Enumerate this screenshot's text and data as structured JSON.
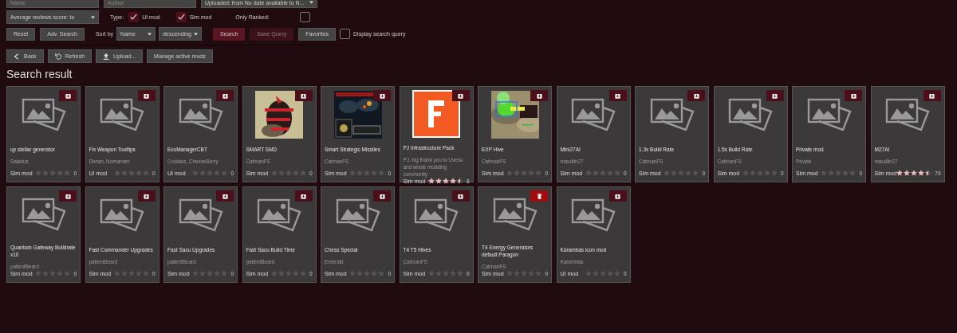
{
  "filters": {
    "row1": [
      {
        "kind": "input",
        "placeholder": "Name"
      },
      {
        "kind": "input",
        "placeholder": "Author"
      },
      {
        "kind": "dropdown",
        "value": "Uploaded: from No date available to N..."
      }
    ],
    "score_dropdown": {
      "value": "Average reviews score:  to"
    },
    "type_label": "Type:",
    "type_options": [
      {
        "label": "UI mod",
        "checked": true
      },
      {
        "label": "Sim mod",
        "checked": true
      }
    ],
    "only_ranked": {
      "label": "Only Ranked:",
      "checked": false
    },
    "reset": "Reset",
    "adv_search": "Adv. Search",
    "sort_label": "Sort by",
    "sort_field": {
      "value": "Name"
    },
    "sort_order": {
      "value": "descending"
    },
    "search": "Search",
    "save_query": {
      "label": "Save Query",
      "disabled": true
    },
    "favorites": "Favorites",
    "display_query": {
      "label": "Display search query",
      "checked": false
    }
  },
  "toolbar": [
    {
      "kind": "back",
      "label": "Back"
    },
    {
      "kind": "refresh",
      "label": "Refresh"
    },
    {
      "kind": "upload",
      "label": "Upload..."
    },
    {
      "kind": "plain",
      "label": "Manage active mods"
    }
  ],
  "heading": "Search result",
  "mods": [
    {
      "title": "up stellar generator",
      "author": "Salarius",
      "type": "Sim mod",
      "stars": 0,
      "count": "0",
      "installed": false
    },
    {
      "title": "Fix Weapon Tooltips",
      "author": "Divran, Nomander",
      "type": "UI mod",
      "stars": 0,
      "count": "0",
      "installed": false
    },
    {
      "title": "EcoManagerCBT",
      "author": "Crotalus, CheeseBerry",
      "type": "UI mod",
      "stars": 0,
      "count": "0",
      "installed": false
    },
    {
      "kind": "picture",
      "title": "SMART SMD",
      "author": "CatmanFS",
      "type": "Sim mod",
      "stars": 0,
      "count": "0",
      "installed": false
    },
    {
      "kind": "picture",
      "title": "Smart Strategic Missiles",
      "author": "CatmanFS",
      "type": "Sim mod",
      "stars": 0,
      "count": "0",
      "installed": false
    },
    {
      "kind": "picture",
      "title": "PJ Infrastructure Pack",
      "author": "PJ, big thank you to Uveso and whole modding community",
      "type": "Sim mod",
      "stars": 4.5,
      "count": "8",
      "installed": false
    },
    {
      "kind": "picture",
      "title": "EXP Hive",
      "author": "CatmanFS",
      "type": "Sim mod",
      "stars": 0,
      "count": "0",
      "installed": false
    },
    {
      "title": "Mini27AI",
      "author": "maudlin27",
      "type": "Sim mod",
      "stars": 0,
      "count": "0",
      "installed": false
    },
    {
      "title": "1.3x Build Rate",
      "author": "CatmanFS",
      "type": "Sim mod",
      "stars": 0,
      "count": "0",
      "installed": false
    },
    {
      "title": "1.5x Build Rate",
      "author": "CatmanFS",
      "type": "Sim mod",
      "stars": 0,
      "count": "0",
      "installed": false
    },
    {
      "title": "Private mod",
      "author": "Private",
      "type": "Sim mod",
      "stars": 0,
      "count": "0",
      "installed": false
    },
    {
      "title": "M27AI",
      "author": "maudlin27",
      "type": "Sim mod",
      "stars": 4.5,
      "count": "79",
      "installed": false
    },
    {
      "title": "Quantum Gateway Buildrate x10",
      "author": "patientBeard",
      "type": "Sim mod",
      "stars": 0,
      "count": "0",
      "installed": false
    },
    {
      "title": "Fast Commander Upgrades",
      "author": "patientBeard",
      "type": "Sim mod",
      "stars": 0,
      "count": "0",
      "installed": false
    },
    {
      "title": "Fast Sacu Upgrades",
      "author": "patientBeard",
      "type": "Sim mod",
      "stars": 0,
      "count": "0",
      "installed": false
    },
    {
      "title": "Fast Sacu Build Time",
      "author": "patientBeard",
      "type": "Sim mod",
      "stars": 0,
      "count": "0",
      "installed": false
    },
    {
      "title": "Chess Special",
      "author": "Emerald",
      "type": "Sim mod",
      "stars": 0,
      "count": "0",
      "installed": false
    },
    {
      "title": "T4 T5 Hives",
      "author": "CatmanFS",
      "type": "Sim mod",
      "stars": 0,
      "count": "0",
      "installed": false
    },
    {
      "title": "T4 Energy Generators default Paragon",
      "author": "CatmanFS",
      "type": "Sim mod",
      "stars": 0,
      "count": "0",
      "installed": true
    },
    {
      "title": "Karambas icon mod",
      "author": "Karambas",
      "type": "UI mod",
      "stars": 0,
      "count": "0",
      "installed": false
    }
  ]
}
